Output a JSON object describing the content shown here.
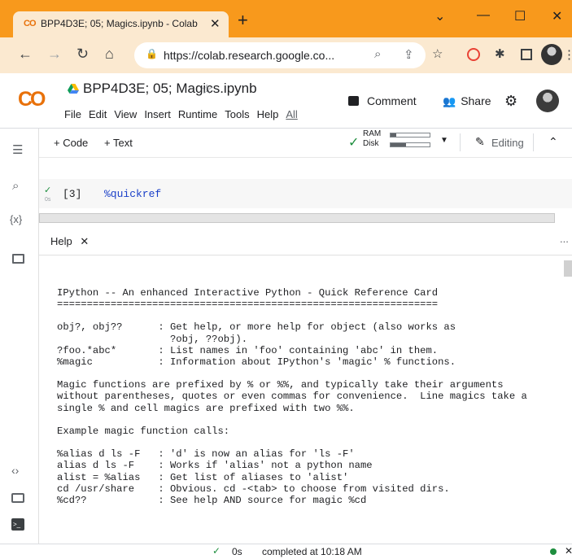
{
  "browser": {
    "tab_logo": "CO",
    "tab_title": "BPP4D3E; 05; Magics.ipynb - Colab",
    "tab_close": "✕",
    "new_tab": "+",
    "url": "https://colab.research.google.co...",
    "window_buttons": {
      "chevron": "⌄",
      "minimize": "—",
      "maximize": "☐",
      "close": "✕"
    }
  },
  "colab": {
    "logo": "CO",
    "notebook_title": "BPP4D3E; 05; Magics.ipynb",
    "menu": [
      "File",
      "Edit",
      "View",
      "Insert",
      "Runtime",
      "Tools",
      "Help"
    ],
    "menu_all": "All",
    "comment_label": "Comment",
    "share_label": "Share"
  },
  "toolbar": {
    "add_code": "+ Code",
    "add_text": "+ Text",
    "ram_label": "RAM",
    "disk_label": "Disk",
    "editing_label": "Editing",
    "ram_fraction": 0.15,
    "disk_fraction": 0.4
  },
  "cell": {
    "exec_time": "0s",
    "prompt": "[3]",
    "code": "%quickref"
  },
  "help_panel": {
    "tab_label": "Help",
    "close": "✕",
    "more": "...",
    "content": "IPython -- An enhanced Interactive Python - Quick Reference Card\n================================================================\n\nobj?, obj??      : Get help, or more help for object (also works as\n                   ?obj, ??obj).\n?foo.*abc*       : List names in 'foo' containing 'abc' in them.\n%magic           : Information about IPython's 'magic' % functions.\n\nMagic functions are prefixed by % or %%, and typically take their arguments\nwithout parentheses, quotes or even commas for convenience.  Line magics take a\nsingle % and cell magics are prefixed with two %%.\n\nExample magic function calls:\n\n%alias d ls -F   : 'd' is now an alias for 'ls -F'\nalias d ls -F    : Works if 'alias' not a python name\nalist = %alias   : Get list of aliases to 'alist'\ncd /usr/share    : Obvious. cd -<tab> to choose from visited dirs.\n%cd??            : See help AND source for magic %cd"
  },
  "statusbar": {
    "check": "✓",
    "time": "0s",
    "text": "completed at 10:18 AM",
    "close": "✕"
  },
  "colors": {
    "titlebar": "#f8991c",
    "tab_active": "#fbe9d0",
    "colab_orange": "#e8710a",
    "success_green": "#1e8e3e",
    "code_blue": "#1a3fc8"
  }
}
